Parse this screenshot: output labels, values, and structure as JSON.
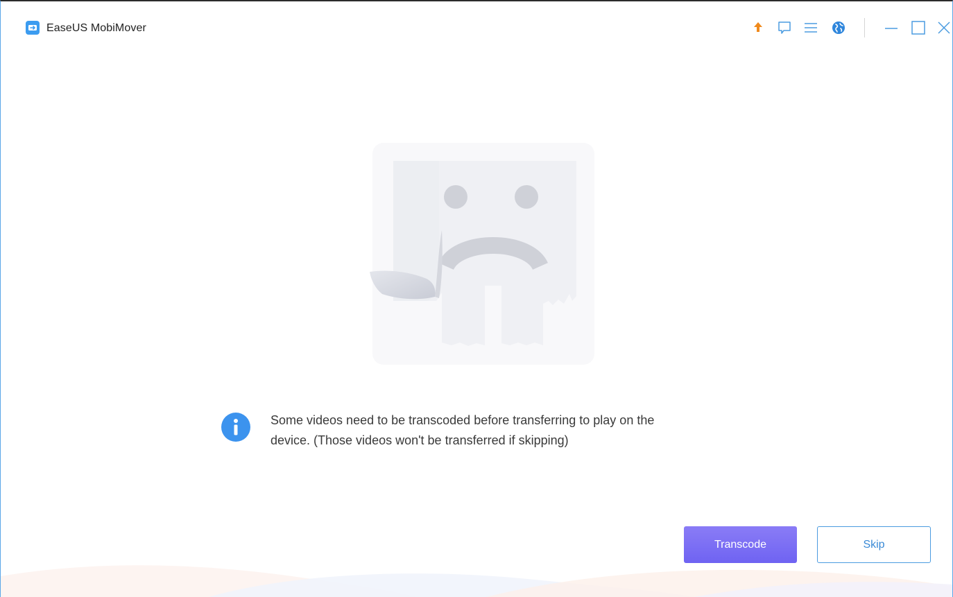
{
  "app": {
    "title": "EaseUS MobiMover",
    "accent_color": "#3c9cf0"
  },
  "titlebar": {
    "icons": [
      "upgrade-arrow-icon",
      "feedback-icon",
      "menu-icon",
      "language-globe-icon"
    ],
    "window_controls": [
      "minimize-icon",
      "maximize-icon",
      "close-icon"
    ]
  },
  "illustration": {
    "icon": "sad-face-torn-paper-icon"
  },
  "message": {
    "icon": "info-icon",
    "line1": "Some videos need to be transcoded before transferring to play on the",
    "line2": "device. (Those videos won't be transferred if skipping)"
  },
  "actions": {
    "transcode_label": "Transcode",
    "skip_label": "Skip",
    "primary_color": "#7b6ff4",
    "secondary_color": "#4a9be0"
  }
}
